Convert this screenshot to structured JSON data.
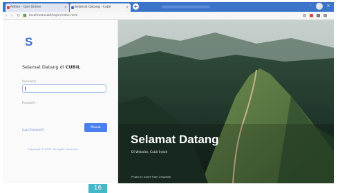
{
  "browser": {
    "tabs": [
      {
        "label": "Admin - Gari Online",
        "fav_color": "#d04b4b"
      },
      {
        "label": "Selamat Datang - Cubil",
        "fav_color": "#3b6fd8"
      }
    ],
    "new_tab_icon": "plus-icon",
    "url": "localhost/cubil/login/index.html"
  },
  "login": {
    "logo_letter": "S",
    "welcome_prefix": "Selamat Datang di ",
    "welcome_brand": "CUBIL",
    "username_label": "Username",
    "username_value": "|",
    "password_label": "Password",
    "forgot_label": "Lupa Password?",
    "login_button": "Masuk",
    "footer_text": "Copyright © 2023. All rights reserved."
  },
  "hero": {
    "title": "Selamat Datang",
    "subtitle": "Di Website, Cubil Indah",
    "credit": "Photo by name from Unsplash"
  },
  "overlay_badge": "16",
  "colors": {
    "accent": "#3b6fd8",
    "tabbar": "#3c74c9",
    "button": "#4a7ff0",
    "badge": "#43b8c6"
  }
}
